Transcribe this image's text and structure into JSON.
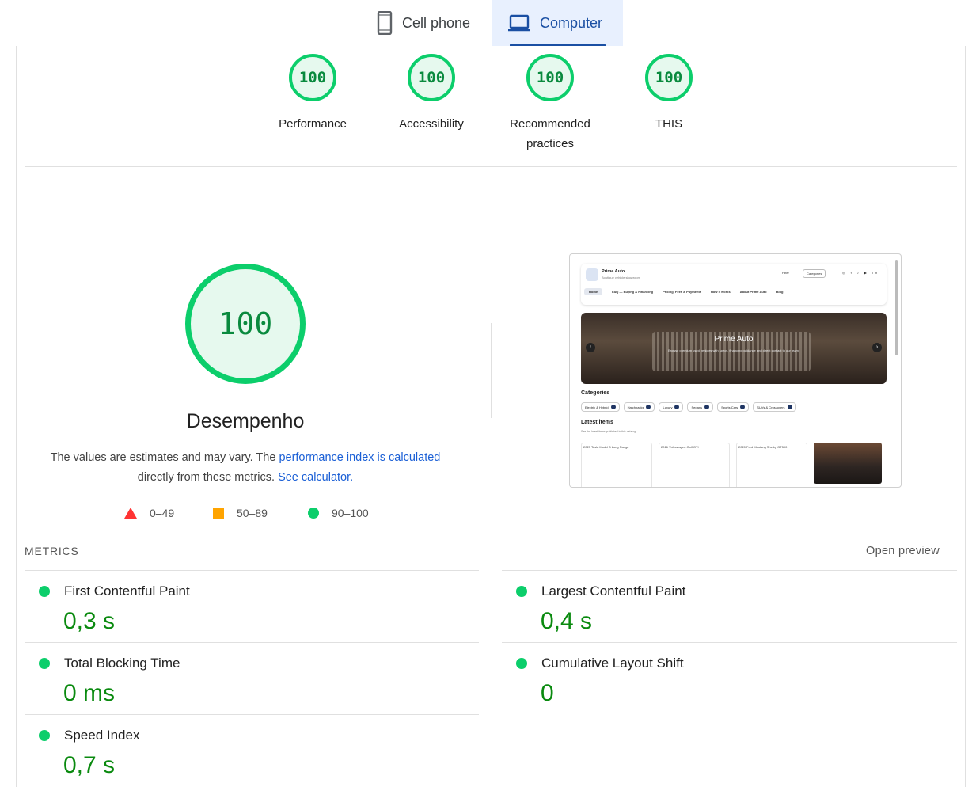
{
  "tabs": {
    "mobile_label": "Cell phone",
    "desktop_label": "Computer"
  },
  "gauges": [
    {
      "score": "100",
      "label": "Performance"
    },
    {
      "score": "100",
      "label": "Accessibility"
    },
    {
      "score": "100",
      "label": "Recommended practices"
    },
    {
      "score": "100",
      "label": "THIS"
    }
  ],
  "performance": {
    "score": "100",
    "title": "Desempenho",
    "desc_start": "The values are estimates and may vary. The ",
    "desc_link": "performance index is calculated",
    "desc_mid": " directly from these metrics. ",
    "desc_calc": "See calculator.",
    "legend": {
      "fail": "0–49",
      "average": "50–89",
      "pass": "90–100"
    },
    "colors": {
      "pass": "#0cce6b",
      "average": "#ffa400",
      "fail": "#ff3333"
    }
  },
  "screenshot": {
    "brand": "Prime Auto",
    "tagline": "Boutique vehicle showroom",
    "filter": "Filter",
    "categories_btn": "Categories",
    "nav": [
      "Home",
      "FAQ — Buying & Financing",
      "Pricing, Fees & Payments",
      "How it works",
      "About Prime Auto",
      "Blog"
    ],
    "hero_title": "Prime Auto",
    "hero_sub": "Browse premium used vehicles with specs, financing guidance and direct contact to our team.",
    "categories_title": "Categories",
    "chips": [
      "Electric & Hybrid",
      "Hatchbacks",
      "Luxury",
      "Sedans",
      "Sports Cars",
      "SUVs & Crossovers"
    ],
    "latest_title": "Latest items",
    "latest_sub": "See the latest items published in this catalog",
    "cards": [
      "2023 Tesla Model 3 Long Range",
      "2016 Volkswagen Golf GTI",
      "2020 Ford Mustang Shelby GT500"
    ]
  },
  "metrics": {
    "heading": "METRICS",
    "open_preview": "Open preview",
    "items": [
      {
        "title": "First Contentful Paint",
        "value": "0,3 s"
      },
      {
        "title": "Largest Contentful Paint",
        "value": "0,4 s"
      },
      {
        "title": "Total Blocking Time",
        "value": "0 ms"
      },
      {
        "title": "Cumulative Layout Shift",
        "value": "0"
      },
      {
        "title": "Speed Index",
        "value": "0,7 s"
      }
    ]
  }
}
